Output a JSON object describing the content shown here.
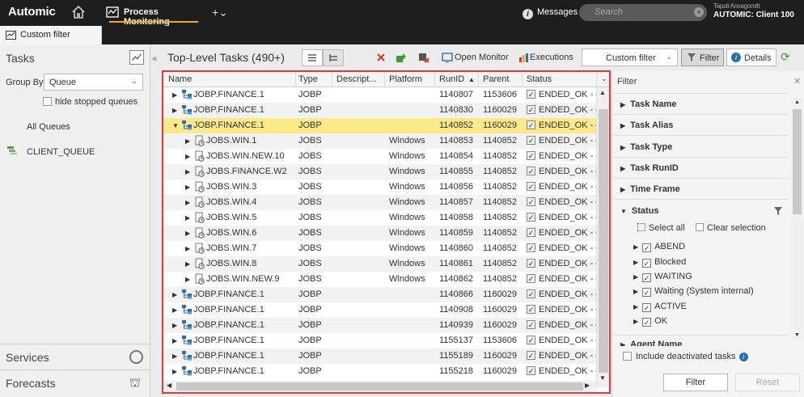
{
  "topbar": {
    "logo": "Automic",
    "tab": "Process Monitoring",
    "plus": "+⌄",
    "messages": "Messages",
    "search_placeholder": "Search",
    "user_small": "Tapsti  Aovagomilt",
    "client": "AUTOMIC: Client 100"
  },
  "subtab": {
    "label": "Custom filter"
  },
  "left": {
    "title": "Tasks",
    "group_by_label": "Group By",
    "group_by_value": "Queue",
    "hide_label": "hide stopped queues",
    "all_queues": "All Queues",
    "queue_item": "CLIENT_QUEUE",
    "services": "Services",
    "forecasts": "Forecasts"
  },
  "toolbar": {
    "title": "Top-Level Tasks (490+)",
    "open_monitor": "Open Monitor",
    "executions": "Executions",
    "custom_filter": "Custom filter",
    "filter": "Filter",
    "details": "Details"
  },
  "table": {
    "columns": [
      "Name",
      "Type",
      "Descript...",
      "Platform",
      "RunID",
      "Parent",
      "Status"
    ],
    "rows": [
      {
        "name": "JOBP.FINANCE.1",
        "type": "JOBP",
        "platform": "",
        "runid": "1140807",
        "parent": "1153606",
        "status": "ENDED_OK - er",
        "child": false,
        "expanded": false,
        "selected": false
      },
      {
        "name": "JOBP.FINANCE.1",
        "type": "JOBP",
        "platform": "",
        "runid": "1140830",
        "parent": "1160029",
        "status": "ENDED_OK - er",
        "child": false,
        "expanded": false,
        "selected": false
      },
      {
        "name": "JOBP.FINANCE.1",
        "type": "JOBP",
        "platform": "",
        "runid": "1140852",
        "parent": "1160029",
        "status": "ENDED_OK - er",
        "child": false,
        "expanded": true,
        "selected": true
      },
      {
        "name": "JOBS.WIN.1",
        "type": "JOBS",
        "platform": "Windows",
        "runid": "1140853",
        "parent": "1140852",
        "status": "ENDED_OK - er",
        "child": true,
        "expanded": false,
        "selected": false
      },
      {
        "name": "JOBS.WIN.NEW.10",
        "type": "JOBS",
        "platform": "Windows",
        "runid": "1140854",
        "parent": "1140852",
        "status": "ENDED_OK - er",
        "child": true,
        "expanded": false,
        "selected": false
      },
      {
        "name": "JOBS.FINANCE.W2",
        "type": "JOBS",
        "platform": "Windows",
        "runid": "1140855",
        "parent": "1140852",
        "status": "ENDED_OK - er",
        "child": true,
        "expanded": false,
        "selected": false
      },
      {
        "name": "JOBS.WIN.3",
        "type": "JOBS",
        "platform": "Windows",
        "runid": "1140856",
        "parent": "1140852",
        "status": "ENDED_OK - er",
        "child": true,
        "expanded": false,
        "selected": false
      },
      {
        "name": "JOBS.WIN.4",
        "type": "JOBS",
        "platform": "Windows",
        "runid": "1140857",
        "parent": "1140852",
        "status": "ENDED_OK - er",
        "child": true,
        "expanded": false,
        "selected": false
      },
      {
        "name": "JOBS.WIN.5",
        "type": "JOBS",
        "platform": "Windows",
        "runid": "1140858",
        "parent": "1140852",
        "status": "ENDED_OK - er",
        "child": true,
        "expanded": false,
        "selected": false
      },
      {
        "name": "JOBS.WIN.6",
        "type": "JOBS",
        "platform": "Windows",
        "runid": "1140859",
        "parent": "1140852",
        "status": "ENDED_OK - er",
        "child": true,
        "expanded": false,
        "selected": false
      },
      {
        "name": "JOBS.WIN.7",
        "type": "JOBS",
        "platform": "Windows",
        "runid": "1140860",
        "parent": "1140852",
        "status": "ENDED_OK - er",
        "child": true,
        "expanded": false,
        "selected": false
      },
      {
        "name": "JOBS.WIN.8",
        "type": "JOBS",
        "platform": "Windows",
        "runid": "1140861",
        "parent": "1140852",
        "status": "ENDED_OK - er",
        "child": true,
        "expanded": false,
        "selected": false
      },
      {
        "name": "JOBS.WIN.NEW.9",
        "type": "JOBS",
        "platform": "Windows",
        "runid": "1140862",
        "parent": "1140852",
        "status": "ENDED_OK - er",
        "child": true,
        "expanded": false,
        "selected": false
      },
      {
        "name": "JOBP.FINANCE.1",
        "type": "JOBP",
        "platform": "",
        "runid": "1140866",
        "parent": "1160029",
        "status": "ENDED_OK - er",
        "child": false,
        "expanded": false,
        "selected": false
      },
      {
        "name": "JOBP.FINANCE.1",
        "type": "JOBP",
        "platform": "",
        "runid": "1140908",
        "parent": "1160029",
        "status": "ENDED_OK - er",
        "child": false,
        "expanded": false,
        "selected": false
      },
      {
        "name": "JOBP.FINANCE.1",
        "type": "JOBP",
        "platform": "",
        "runid": "1140939",
        "parent": "1160029",
        "status": "ENDED_OK - er",
        "child": false,
        "expanded": false,
        "selected": false
      },
      {
        "name": "JOBP.FINANCE.1",
        "type": "JOBP",
        "platform": "",
        "runid": "1155137",
        "parent": "1153606",
        "status": "ENDED_OK - er",
        "child": false,
        "expanded": false,
        "selected": false
      },
      {
        "name": "JOBP.FINANCE.1",
        "type": "JOBP",
        "platform": "",
        "runid": "1155189",
        "parent": "1160029",
        "status": "ENDED_OK - er",
        "child": false,
        "expanded": false,
        "selected": false
      },
      {
        "name": "JOBP.FINANCE.1",
        "type": "JOBP",
        "platform": "",
        "runid": "1155218",
        "parent": "1160029",
        "status": "ENDED_OK - er",
        "child": false,
        "expanded": false,
        "selected": false
      }
    ]
  },
  "filter_panel": {
    "header": "Filter",
    "sections": [
      "Task Name",
      "Task Alias",
      "Task Type",
      "Task RunID",
      "Time Frame"
    ],
    "status_title": "Status",
    "select_all": "Select all",
    "clear_selection": "Clear selection",
    "statuses": [
      "ABEND",
      "Blocked",
      "WAITING",
      "Waiting (System internal)",
      "ACTIVE",
      "OK"
    ],
    "agent_name": "Agent Name",
    "include_deactivated": "Include deactivated tasks",
    "filter_button": "Filter",
    "reset_button": "Reset"
  },
  "colors": {
    "highlight": "#fce98a",
    "table_border": "#e53935",
    "accent": "#f5a623"
  }
}
